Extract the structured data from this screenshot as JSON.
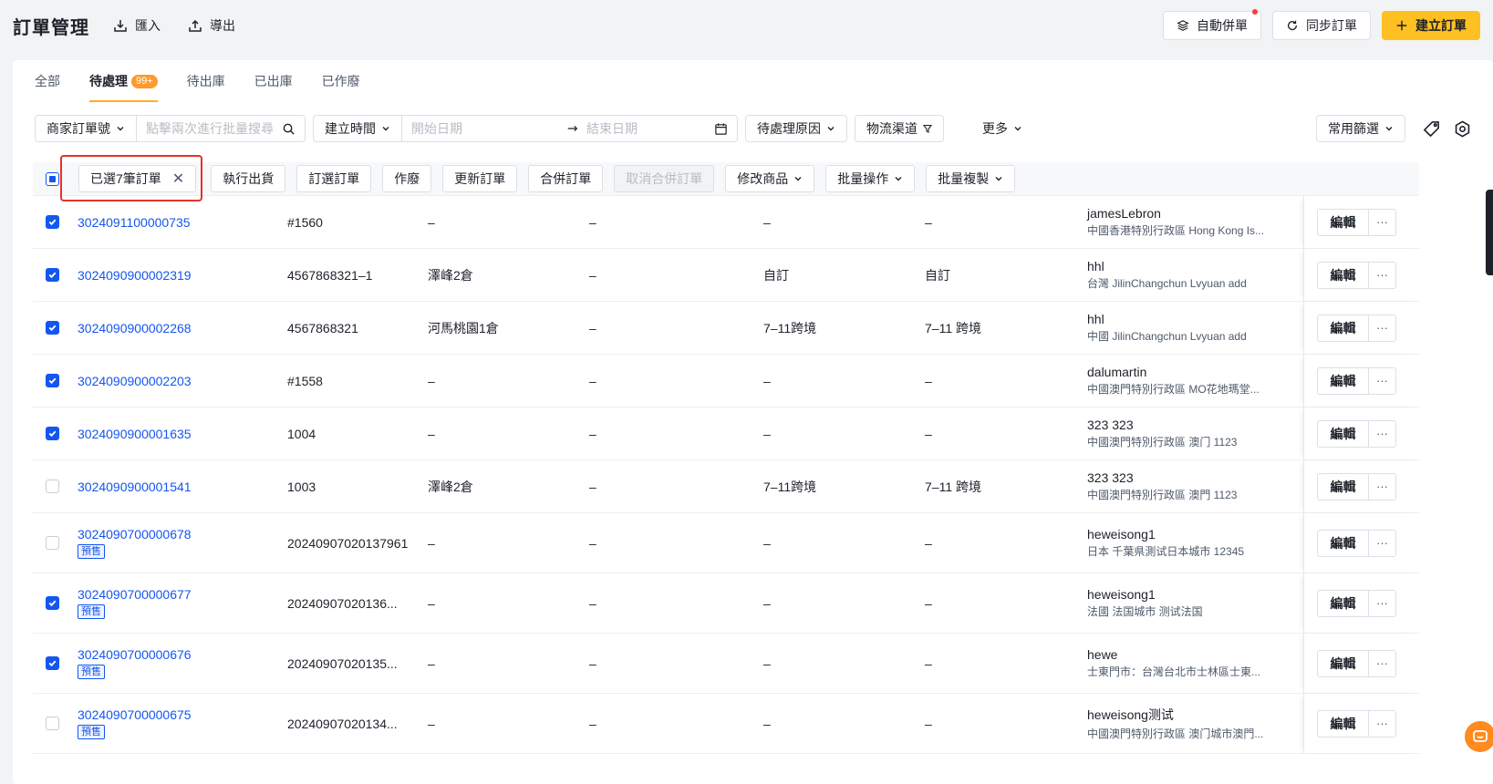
{
  "header": {
    "title": "訂單管理",
    "import_label": "匯入",
    "export_label": "導出",
    "auto_merge_label": "自動併單",
    "sync_label": "同步訂單",
    "create_label": "建立訂單"
  },
  "tabs": [
    {
      "label": "全部"
    },
    {
      "label": "待處理",
      "badge": "99+"
    },
    {
      "label": "待出庫"
    },
    {
      "label": "已出庫"
    },
    {
      "label": "已作廢"
    }
  ],
  "filters": {
    "order_field": "商家訂單號",
    "search_placeholder": "點擊兩次進行批量搜尋",
    "time_field": "建立時間",
    "start_placeholder": "開始日期",
    "end_placeholder": "結束日期",
    "reason": "待處理原因",
    "logistics": "物流渠道",
    "more": "更多",
    "common_filter": "常用篩選"
  },
  "toolbar": {
    "selected_label": "已選7筆訂單",
    "ship": "執行出貨",
    "book": "訂選訂單",
    "void": "作廢",
    "update": "更新訂單",
    "merge": "合併訂單",
    "cancel_merge": "取消合併訂單",
    "edit_products": "修改商品",
    "batch_ops": "批量操作",
    "batch_copy": "批量複製"
  },
  "actions": {
    "edit": "編輯",
    "more": "···"
  },
  "rows": [
    {
      "checked": true,
      "order": "3024091100000735",
      "presale": "",
      "ext": "#1560",
      "wh": "–",
      "d4": "–",
      "d5": "–",
      "d6": "–",
      "buyer": "jamesLebron",
      "addr": "中國香港特別行政區 Hong Kong Is..."
    },
    {
      "checked": true,
      "order": "3024090900002319",
      "presale": "",
      "ext": "4567868321–1",
      "wh": "澤峰2倉",
      "d4": "–",
      "d5": "自訂",
      "d6": "自訂",
      "buyer": "hhl",
      "addr": "台灣 JilinChangchun Lvyuan add"
    },
    {
      "checked": true,
      "order": "3024090900002268",
      "presale": "",
      "ext": "4567868321",
      "wh": "河馬桃園1倉",
      "d4": "–",
      "d5": "7–11跨境",
      "d6": "7–11 跨境",
      "buyer": "hhl",
      "addr": "中國 JilinChangchun Lvyuan add"
    },
    {
      "checked": true,
      "order": "3024090900002203",
      "presale": "",
      "ext": "#1558",
      "wh": "–",
      "d4": "–",
      "d5": "–",
      "d6": "–",
      "buyer": "dalumartin",
      "addr": "中國澳門特別行政區 MO花地瑪堂..."
    },
    {
      "checked": true,
      "order": "3024090900001635",
      "presale": "",
      "ext": "1004",
      "wh": "–",
      "d4": "–",
      "d5": "–",
      "d6": "–",
      "buyer": "323 323",
      "addr": "中國澳門特別行政區 澳门 1123"
    },
    {
      "checked": false,
      "order": "3024090900001541",
      "presale": "",
      "ext": "1003",
      "wh": "澤峰2倉",
      "d4": "–",
      "d5": "7–11跨境",
      "d6": "7–11 跨境",
      "buyer": "323 323",
      "addr": "中國澳門特別行政區 澳門 1123"
    },
    {
      "checked": false,
      "order": "3024090700000678",
      "presale": "預售",
      "ext": "20240907020137961",
      "wh": "–",
      "d4": "–",
      "d5": "–",
      "d6": "–",
      "buyer": "heweisong1",
      "addr": "日本 千葉県測试日本城市 12345"
    },
    {
      "checked": true,
      "order": "3024090700000677",
      "presale": "預售",
      "ext": "20240907020136...",
      "wh": "–",
      "d4": "–",
      "d5": "–",
      "d6": "–",
      "buyer": "heweisong1",
      "addr": "法國 法国城市 测试法国"
    },
    {
      "checked": true,
      "order": "3024090700000676",
      "presale": "預售",
      "ext": "20240907020135...",
      "wh": "–",
      "d4": "–",
      "d5": "–",
      "d6": "–",
      "buyer": "hewe",
      "addr": "士東門市：台灣台北市士林區士東..."
    },
    {
      "checked": false,
      "order": "3024090700000675",
      "presale": "預售",
      "ext": "20240907020134...",
      "wh": "–",
      "d4": "–",
      "d5": "–",
      "d6": "–",
      "buyer": "heweisong测试",
      "addr": "中國澳門特別行政區 澳门城市澳門..."
    }
  ]
}
